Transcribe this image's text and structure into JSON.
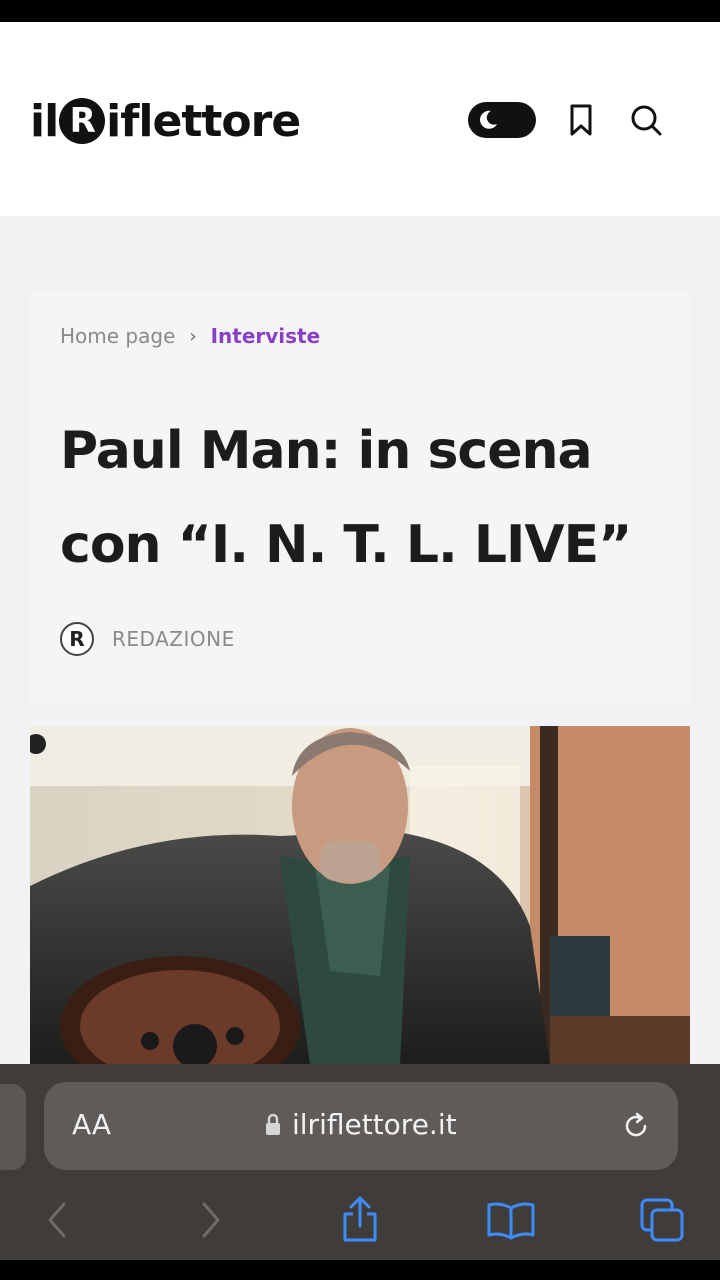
{
  "site": {
    "logo_prefix": "il",
    "logo_r": "R",
    "logo_suffix": "iflettore"
  },
  "header": {
    "icons": [
      "moon-icon",
      "bookmark-icon",
      "search-icon"
    ]
  },
  "breadcrumb": {
    "home": "Home page",
    "separator": "›",
    "current": "Interviste"
  },
  "article": {
    "title": "Paul Man: in scena con “I. N. T. L. LIVE”",
    "author_initial": "R",
    "author": "REDAZIONE"
  },
  "browser": {
    "text_size_label": "AA",
    "url": "ilriflettore.it",
    "icons": [
      "lock-icon",
      "reload-icon",
      "back-icon",
      "forward-icon",
      "share-icon",
      "bookmarks-icon",
      "tabs-icon"
    ]
  },
  "colors": {
    "accent": "#8a3fc4",
    "browser_chrome": "#3f3c3a",
    "ios_blue": "#3d8bff"
  }
}
